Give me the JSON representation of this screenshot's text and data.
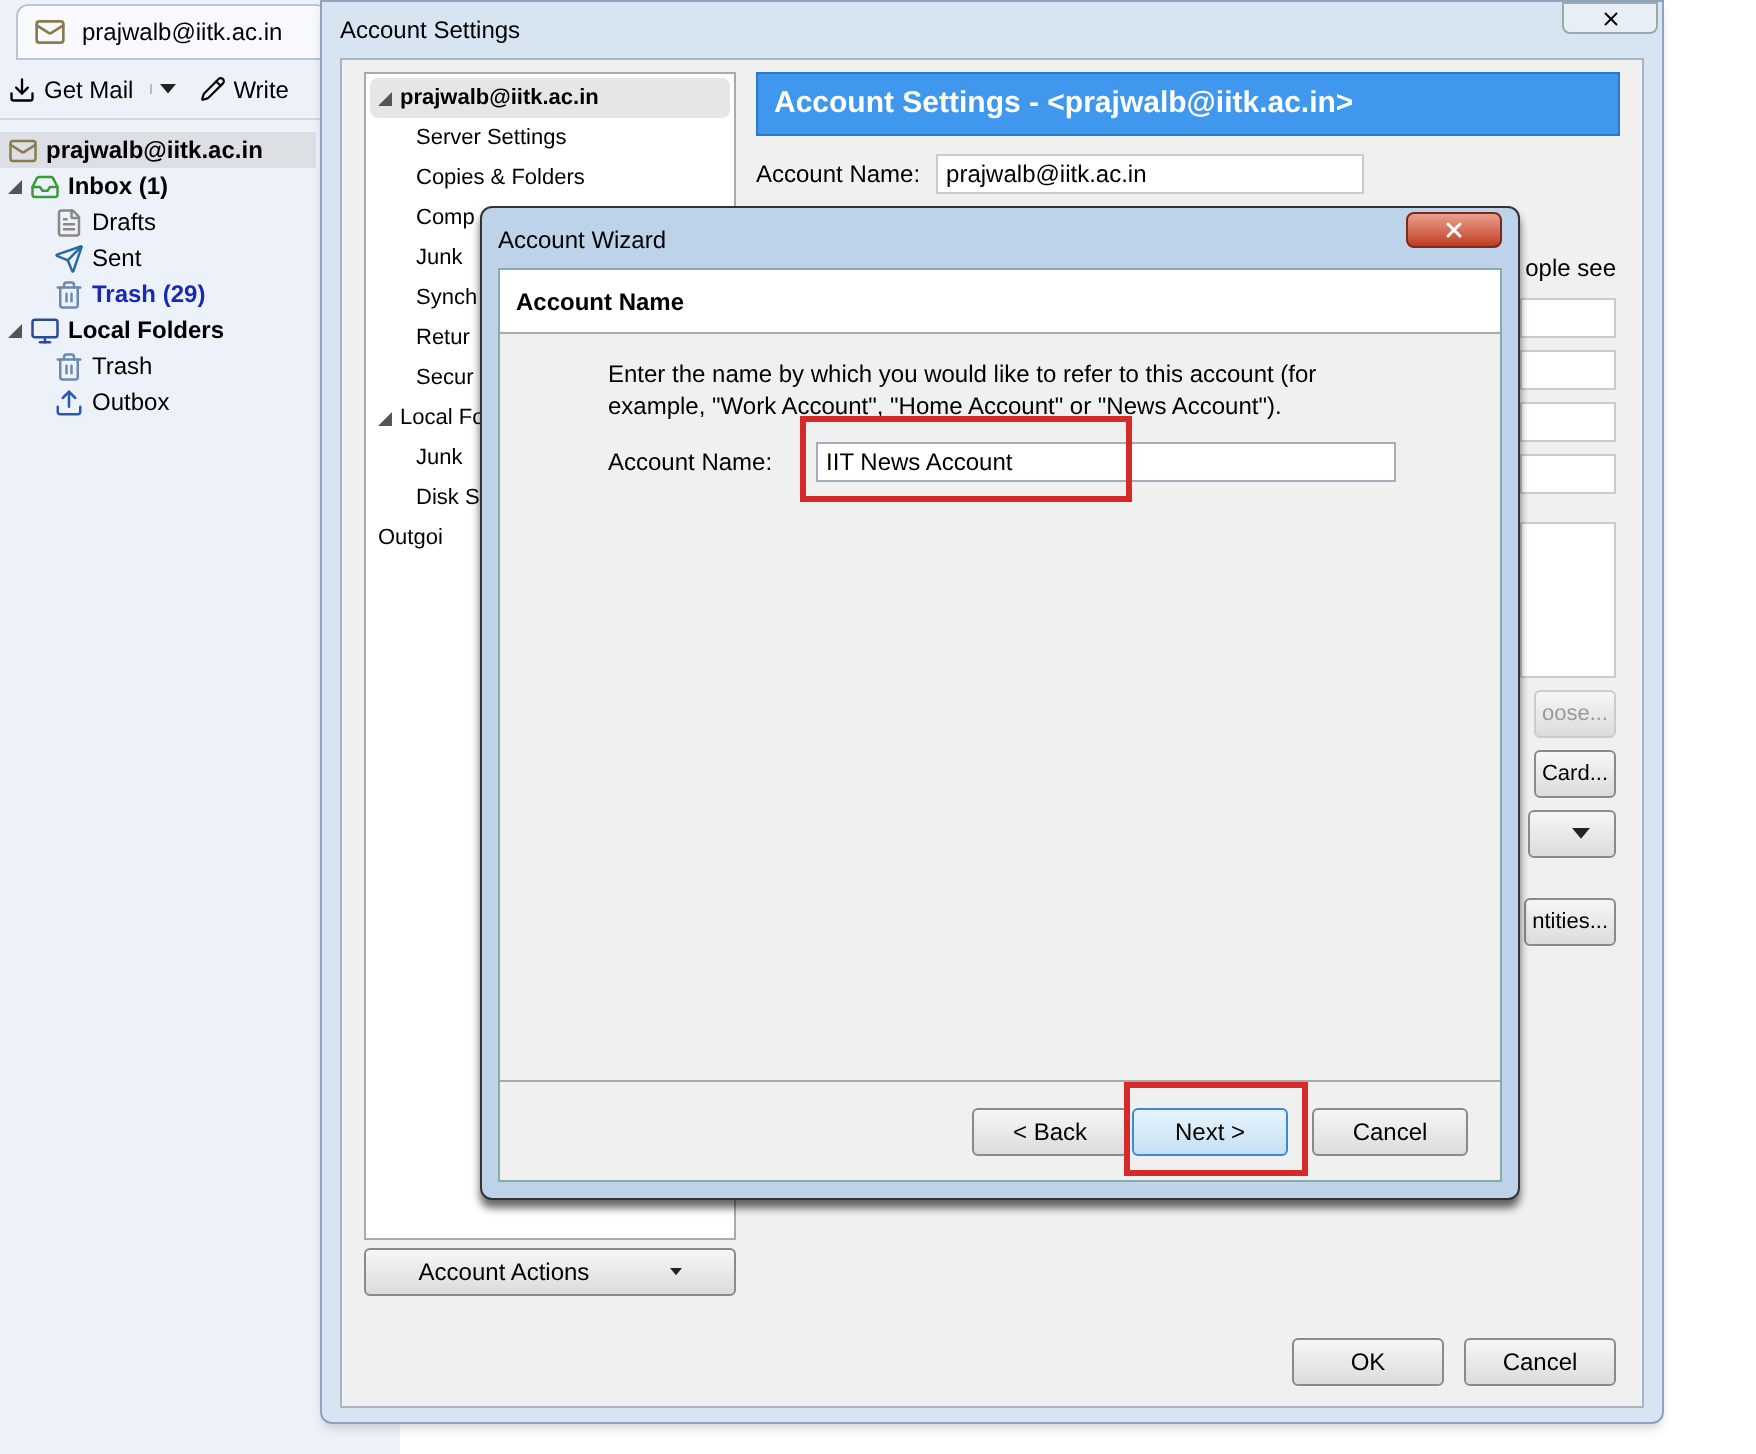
{
  "mail_app": {
    "tab": {
      "label": "prajwalb@iitk.ac.in"
    },
    "toolbar": [
      {
        "label": "Get Mail",
        "kind": "getmail"
      },
      {
        "label": "Write",
        "kind": "write"
      }
    ],
    "account": {
      "label": "prajwalb@iitk.ac.in",
      "selected": true
    },
    "folders": [
      {
        "label": "Inbox (1)",
        "kind": "inbox",
        "unread": true,
        "new_mail": false,
        "expanded": true,
        "children": [
          {
            "label": "Drafts",
            "kind": "drafts",
            "unread": false,
            "new_mail": false
          },
          {
            "label": "Sent",
            "kind": "sent",
            "unread": false,
            "new_mail": false
          },
          {
            "label": "Trash (29)",
            "kind": "trash",
            "unread": true,
            "new_mail": true
          }
        ]
      },
      {
        "label": "Local Folders",
        "kind": "local",
        "unread": true,
        "new_mail": false,
        "expanded": true,
        "children": [
          {
            "label": "Trash",
            "kind": "trash",
            "unread": false,
            "new_mail": false
          },
          {
            "label": "Outbox",
            "kind": "outbox",
            "unread": false,
            "new_mail": false
          }
        ]
      }
    ]
  },
  "settings_window": {
    "title": "Account Settings",
    "tree": [
      {
        "label": "prajwalb@iitk.ac.in",
        "selected": true,
        "expanded": true,
        "children": [
          {
            "label": "Server Settings",
            "selected": false
          },
          {
            "label": "Copies & Folders",
            "selected": false
          },
          {
            "label": "Comp",
            "selected": false
          },
          {
            "label": "Junk",
            "selected": false
          },
          {
            "label": "Synch",
            "selected": false
          },
          {
            "label": "Retur",
            "selected": false
          },
          {
            "label": "Secur",
            "selected": false
          }
        ]
      },
      {
        "label": "Local Fo",
        "selected": false,
        "expanded": true,
        "children": [
          {
            "label": "Junk",
            "selected": false
          },
          {
            "label": "Disk S",
            "selected": false
          }
        ]
      },
      {
        "label": "Outgoi",
        "selected": false
      }
    ],
    "account_actions": "Account Actions",
    "header": "Account Settings - <prajwalb@iitk.ac.in>",
    "account_name": {
      "label": "Account Name:",
      "value": "prajwalb@iitk.ac.in"
    },
    "partial_text": "ople see",
    "partial_buttons": [
      {
        "label": "oose...",
        "disabled": true
      },
      {
        "label": "Card...",
        "disabled": false
      }
    ],
    "partial_button_2": "ntities...",
    "buttons": [
      "OK",
      "Cancel"
    ]
  },
  "wizard": {
    "title": "Account Wizard",
    "heading": "Account Name",
    "description": "Enter the name by which you would like to refer to this account (for example, \"Work Account\", \"Home Account\" or \"News Account\").",
    "field": {
      "label": "Account Name:",
      "value": "IIT News Account",
      "highlighted": true
    },
    "buttons": [
      {
        "label": "< Back",
        "focused": false,
        "highlighted": false
      },
      {
        "label": "Next >",
        "focused": true,
        "highlighted": true
      },
      {
        "label": "Cancel",
        "focused": false,
        "highlighted": false
      }
    ]
  }
}
